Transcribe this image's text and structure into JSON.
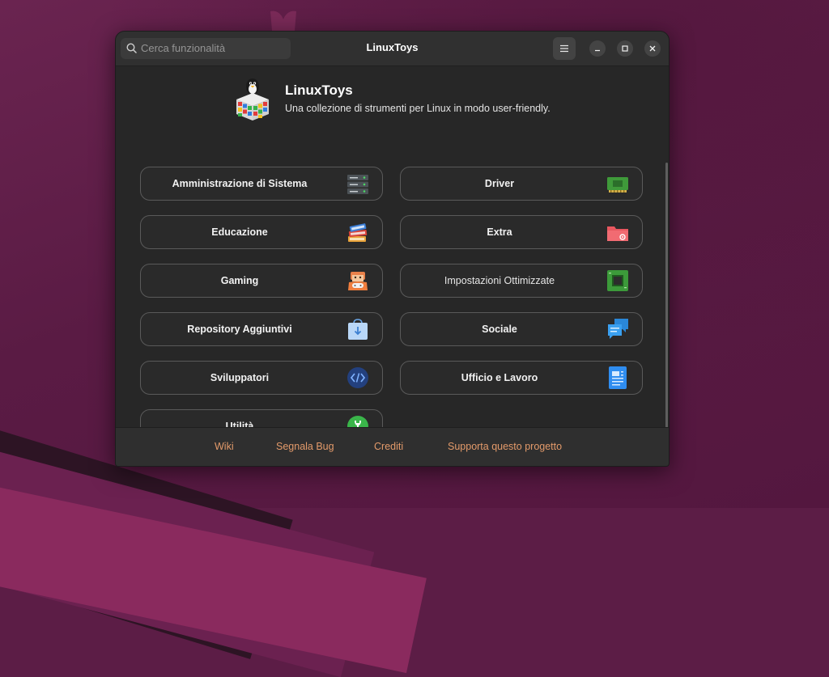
{
  "window": {
    "title": "LinuxToys"
  },
  "search": {
    "placeholder": "Cerca funzionalità"
  },
  "hero": {
    "title": "LinuxToys",
    "subtitle": "Una collezione di strumenti per Linux in modo user-friendly."
  },
  "categories": [
    {
      "label": "Amministrazione di Sistema",
      "icon": "server-icon"
    },
    {
      "label": "Driver",
      "icon": "circuit-board-icon"
    },
    {
      "label": "Educazione",
      "icon": "books-icon"
    },
    {
      "label": "Extra",
      "icon": "folder-gear-icon"
    },
    {
      "label": "Gaming",
      "icon": "gamer-icon"
    },
    {
      "label": "Impostazioni Ottimizzate",
      "icon": "chip-icon"
    },
    {
      "label": "Repository Aggiuntivi",
      "icon": "shopping-bag-icon"
    },
    {
      "label": "Sociale",
      "icon": "chat-bubbles-icon"
    },
    {
      "label": "Sviluppatori",
      "icon": "code-icon"
    },
    {
      "label": "Ufficio e Lavoro",
      "icon": "document-icon"
    },
    {
      "label": "Utilità",
      "icon": "wrench-icon"
    }
  ],
  "footer": {
    "links": [
      "Wiki",
      "Segnala Bug",
      "Crediti",
      "Supporta questo progetto"
    ]
  },
  "colors": {
    "window_bg": "#272727",
    "headerbar_bg": "#303030",
    "link": "#e39a6a",
    "desktop": "#5c1d46"
  }
}
